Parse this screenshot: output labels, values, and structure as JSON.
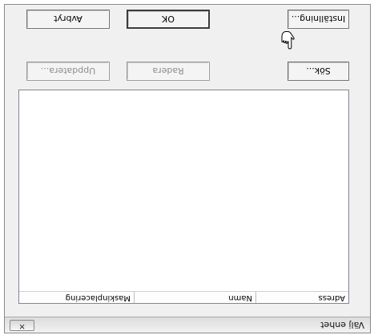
{
  "window": {
    "title": "Välj enhet",
    "close_glyph": "✕"
  },
  "list": {
    "columns": [
      "Adress",
      "Namn",
      "Maskinplacering"
    ],
    "rows": []
  },
  "buttons": {
    "search": "Sök...",
    "delete": "Radera",
    "update": "Uppdatera...",
    "settings": "Inställning...",
    "ok": "OK",
    "cancel": "Avbryt"
  },
  "colors": {
    "dialog_bg": "#f0f0f0",
    "list_bg": "#ffffff"
  },
  "icons": {
    "cursor": "hand-pointer-icon"
  }
}
